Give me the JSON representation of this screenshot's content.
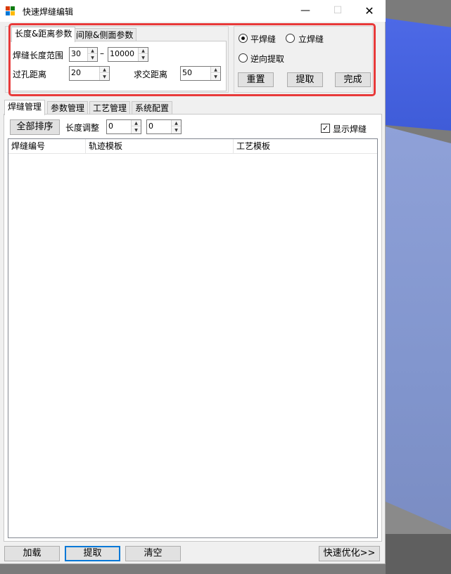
{
  "window": {
    "title": "快速焊缝编辑",
    "minimize_glyph": "—",
    "maximize_glyph": "☐",
    "close_glyph": "✕"
  },
  "param_tabs": [
    {
      "label": "长度&距离参数",
      "active": true
    },
    {
      "label": "间隙&侧面参数",
      "active": false
    }
  ],
  "length_params": {
    "weld_length_label": "焊缝长度范围",
    "min_value": "30",
    "range_dash": "–",
    "max_value": "10000",
    "hole_distance_label": "过孔距离",
    "hole_distance_value": "20",
    "intersect_distance_label": "求交距离",
    "intersect_distance_value": "50"
  },
  "weld_type": {
    "flat_label": "平焊缝",
    "flat_selected": true,
    "vertical_label": "立焊缝",
    "vertical_selected": false,
    "reverse_label": "逆向提取",
    "reverse_selected": false
  },
  "actions": {
    "reset": "重置",
    "extract": "提取",
    "finish": "完成"
  },
  "main_tabs": [
    {
      "label": "焊缝管理",
      "active": true
    },
    {
      "label": "参数管理",
      "active": false
    },
    {
      "label": "工艺管理",
      "active": false
    },
    {
      "label": "系统配置",
      "active": false
    }
  ],
  "toolbar": {
    "sort_all": "全部排序",
    "length_adjust_label": "长度调整",
    "adjust_value_1": "0",
    "adjust_value_2": "0",
    "show_weld_label": "显示焊缝",
    "show_weld_checked": true
  },
  "table": {
    "columns": [
      "焊缝编号",
      "轨迹模板",
      "工艺模板"
    ],
    "rows": []
  },
  "bottom_buttons": {
    "load": "加载",
    "extract": "提取",
    "clear": "清空",
    "quick_optimize": "快速优化>>"
  },
  "colors": {
    "highlight": "#e83a3a",
    "accent": "#0078d7",
    "viewport_blue": "#4d69e6"
  }
}
